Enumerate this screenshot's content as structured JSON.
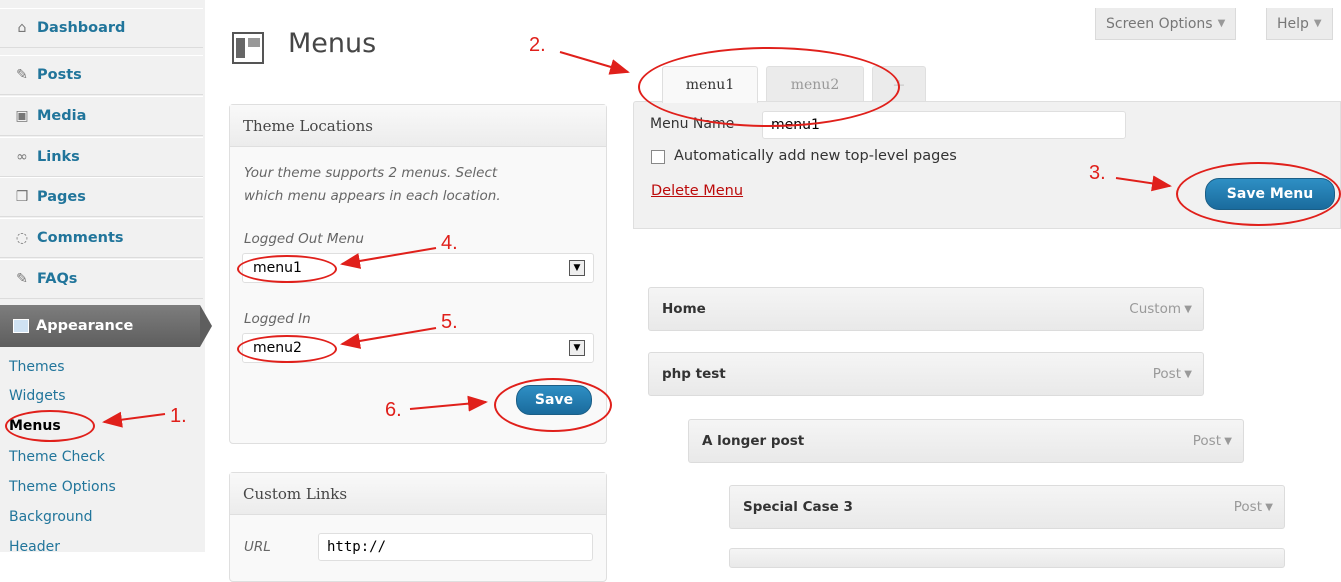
{
  "sidebar": {
    "items": [
      {
        "label": "Dashboard",
        "icon": "house-icon"
      },
      {
        "label": "Posts",
        "icon": "pin-icon"
      },
      {
        "label": "Media",
        "icon": "media-icon"
      },
      {
        "label": "Links",
        "icon": "link-icon"
      },
      {
        "label": "Pages",
        "icon": "pages-icon"
      },
      {
        "label": "Comments",
        "icon": "comment-icon"
      },
      {
        "label": "FAQs",
        "icon": "pin-icon"
      }
    ],
    "appearance": {
      "label": "Appearance",
      "icon": "appearance-icon"
    },
    "submenu": [
      "Themes",
      "Widgets",
      "Menus",
      "Theme Check",
      "Theme Options",
      "Background",
      "Header"
    ],
    "current_submenu": "Menus"
  },
  "header": {
    "title": "Menus",
    "screen_options": "Screen Options",
    "help": "Help"
  },
  "theme_locations": {
    "title": "Theme Locations",
    "description_line1": "Your theme supports 2 menus. Select",
    "description_line2": "which menu appears in each location.",
    "logged_out_label": "Logged Out Menu",
    "logged_out_value": "menu1",
    "logged_in_label": "Logged In",
    "logged_in_value": "menu2",
    "save_label": "Save"
  },
  "custom_links": {
    "title": "Custom Links",
    "url_label": "URL",
    "url_value": "http://"
  },
  "menu_tabs": [
    "menu1",
    "menu2",
    "+"
  ],
  "menu_editor": {
    "name_label": "Menu Name",
    "name_value": "menu1",
    "auto_add_label": "Automatically add new top-level pages",
    "auto_add_checked": false,
    "delete_label": "Delete Menu",
    "save_label": "Save Menu"
  },
  "menu_items": [
    {
      "title": "Home",
      "type": "Custom"
    },
    {
      "title": "php test",
      "type": "Post"
    },
    {
      "title": "A longer post",
      "type": "Post"
    },
    {
      "title": "Special Case 3",
      "type": "Post"
    }
  ],
  "annotations": [
    "1.",
    "2.",
    "3.",
    "4.",
    "5.",
    "6."
  ],
  "colors": {
    "link": "#21759b",
    "annotation": "#e0201b",
    "button": "#21759b",
    "delete": "#bc0b0b"
  }
}
